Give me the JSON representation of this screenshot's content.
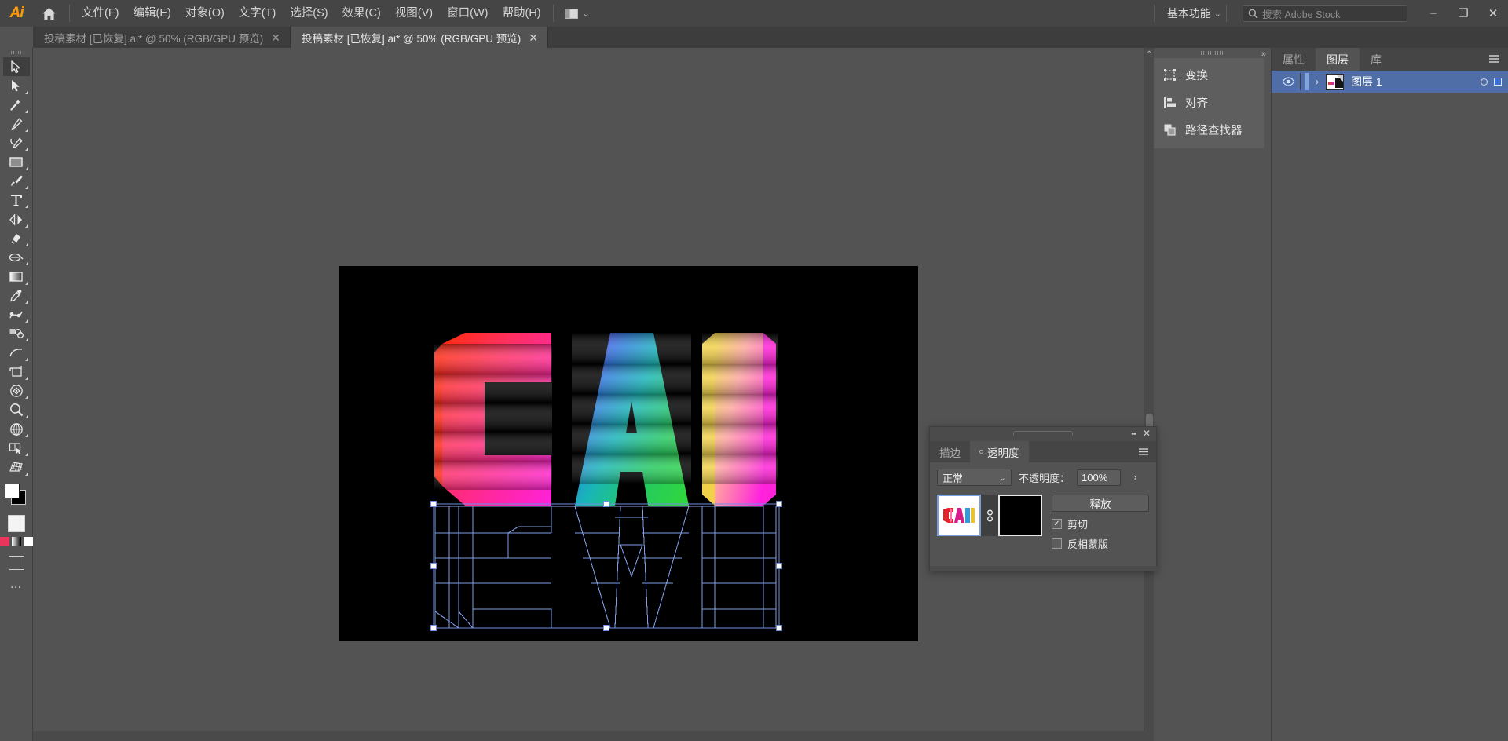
{
  "app": {
    "name": "Adobe Illustrator",
    "logo_text": "Ai",
    "home_icon": "home-icon"
  },
  "menubar": {
    "items": [
      {
        "label": "文件(F)"
      },
      {
        "label": "编辑(E)"
      },
      {
        "label": "对象(O)"
      },
      {
        "label": "文字(T)"
      },
      {
        "label": "选择(S)"
      },
      {
        "label": "效果(C)"
      },
      {
        "label": "视图(V)"
      },
      {
        "label": "窗口(W)"
      },
      {
        "label": "帮助(H)"
      }
    ],
    "arrange_icon": "arrange-documents-icon",
    "arrange_caret": "⌄",
    "workspace": {
      "label": "基本功能",
      "caret": "⌄"
    },
    "search": {
      "icon": "search-icon",
      "placeholder": "搜索 Adobe Stock",
      "value": ""
    },
    "window_controls": {
      "minimize": "−",
      "restore": "❐",
      "close": "✕"
    }
  },
  "tabs": [
    {
      "title": "投稿素材 [已恢复].ai* @ 50% (RGB/GPU 预览)",
      "close": "✕",
      "active": false
    },
    {
      "title": "投稿素材 [已恢复].ai* @ 50% (RGB/GPU 预览)",
      "close": "✕",
      "active": true
    }
  ],
  "toolbar": {
    "tools": [
      {
        "name": "selection-tool",
        "selected": true,
        "has_flyout": false
      },
      {
        "name": "direct-selection-tool",
        "selected": false,
        "has_flyout": true
      },
      {
        "name": "magic-wand-tool",
        "selected": false,
        "has_flyout": true
      },
      {
        "name": "pen-tool",
        "selected": false,
        "has_flyout": true
      },
      {
        "name": "curvature-tool",
        "selected": false,
        "has_flyout": true
      },
      {
        "name": "rectangle-tool",
        "selected": false,
        "has_flyout": true
      },
      {
        "name": "paintbrush-tool",
        "selected": false,
        "has_flyout": true
      },
      {
        "name": "type-tool",
        "selected": false,
        "has_flyout": true
      },
      {
        "name": "reflect-tool",
        "selected": false,
        "has_flyout": true
      },
      {
        "name": "shaper-tool",
        "selected": false,
        "has_flyout": true
      },
      {
        "name": "width-tool",
        "selected": false,
        "has_flyout": true
      },
      {
        "name": "gradient-tool",
        "selected": false,
        "has_flyout": true
      },
      {
        "name": "eyedropper-tool",
        "selected": false,
        "has_flyout": true
      },
      {
        "name": "blend-tool",
        "selected": false,
        "has_flyout": true
      },
      {
        "name": "symbol-sprayer-tool",
        "selected": false,
        "has_flyout": true
      },
      {
        "name": "line-segment-tool",
        "selected": false,
        "has_flyout": true
      },
      {
        "name": "artboard-tool",
        "selected": false,
        "has_flyout": true
      },
      {
        "name": "rotate-tool",
        "selected": false,
        "has_flyout": true
      },
      {
        "name": "zoom-tool",
        "selected": false,
        "has_flyout": true
      },
      {
        "name": "perspective-grid-tool",
        "selected": false,
        "has_flyout": true
      },
      {
        "name": "slice-tool",
        "selected": false,
        "has_flyout": true
      },
      {
        "name": "mesh-tool",
        "selected": false,
        "has_flyout": true
      }
    ],
    "fill_color": "#ffffff",
    "stroke_color": "#000000",
    "more_options": "…"
  },
  "document": {
    "artboard_background": "#000000",
    "zoom": "50%",
    "artwork_text": "CAI",
    "selection_color": "#5b7fd4"
  },
  "dock": {
    "collapse_icon": "double-chevron-icon",
    "items": [
      {
        "label": "变换",
        "icon": "transform-icon"
      },
      {
        "label": "对齐",
        "icon": "align-icon"
      },
      {
        "label": "路径查找器",
        "icon": "pathfinder-icon"
      }
    ]
  },
  "layers_panel": {
    "tabs": [
      {
        "label": "属性",
        "active": false
      },
      {
        "label": "图层",
        "active": true
      },
      {
        "label": "库",
        "active": false
      }
    ],
    "menu_icon": "panel-menu-icon",
    "rows": [
      {
        "visibility_icon": "eye-icon",
        "expand_icon": "›",
        "name": "图层 1",
        "target_icon": "target-circle-icon",
        "select_color": "#3b6fd4",
        "selected": true
      }
    ]
  },
  "transparency_panel": {
    "titlebar": {
      "dots_icon": "panel-options-icon",
      "close_icon": "✕"
    },
    "tabs": [
      {
        "label": "描边",
        "active": false
      },
      {
        "label": "透明度",
        "active": true
      }
    ],
    "menu_icon": "panel-menu-icon",
    "blend_mode": {
      "value": "正常",
      "caret": "⌄"
    },
    "opacity": {
      "label": "不透明度：",
      "value": "100%",
      "arrow": "›"
    },
    "thumbnails": {
      "artwork_label": "artwork-thumbnail",
      "link_icon": "link-icon",
      "mask_label": "opacity-mask-thumbnail",
      "mask_color": "#000000"
    },
    "release_button": "释放",
    "checkboxes": [
      {
        "label": "剪切",
        "checked": true,
        "check_glyph": "✓"
      },
      {
        "label": "反相蒙版",
        "checked": false,
        "check_glyph": ""
      }
    ]
  },
  "scrollbars": {
    "vertical_arrow": "⌃",
    "track_color": "#4a4a4a",
    "thumb_color": "#6e6e6e"
  }
}
